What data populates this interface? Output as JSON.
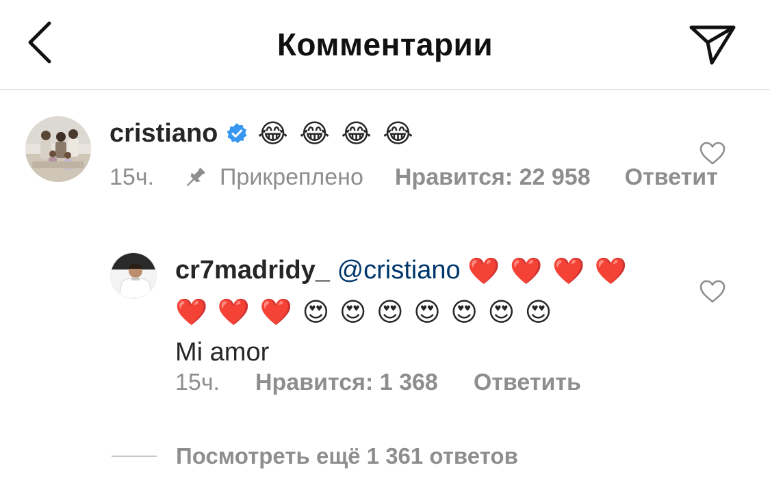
{
  "header": {
    "title": "Комментарии"
  },
  "comments": [
    {
      "username": "cristiano",
      "verified": true,
      "emojis": [
        "😂",
        "😂",
        "😂",
        "😂"
      ],
      "time": "15ч.",
      "pinned_label": "Прикреплено",
      "likes_label": "Нравится: 22 958",
      "reply_label": "Ответит"
    },
    {
      "username": "cr7madridy_",
      "mention": "@cristiano",
      "emojis": [
        "❤️",
        "❤️",
        "❤️",
        "❤️",
        "❤️",
        "❤️",
        "❤️",
        "😍",
        "😍",
        "😍",
        "😍",
        "😍",
        "😍",
        "😍"
      ],
      "message": "Mi amor",
      "time": "15ч.",
      "likes_label": "Нравится: 1 368",
      "reply_label": "Ответить"
    }
  ],
  "view_more_label": "Посмотреть ещё 1 361 ответов",
  "colors": {
    "text": "#262626",
    "secondary": "#8e8e8e",
    "mention": "#00376b",
    "verified": "#3897f0",
    "divider": "#e6e6e6"
  },
  "icons": [
    "back-chevron-icon",
    "send-icon",
    "verified-badge-icon",
    "pin-icon",
    "heart-outline-icon"
  ]
}
